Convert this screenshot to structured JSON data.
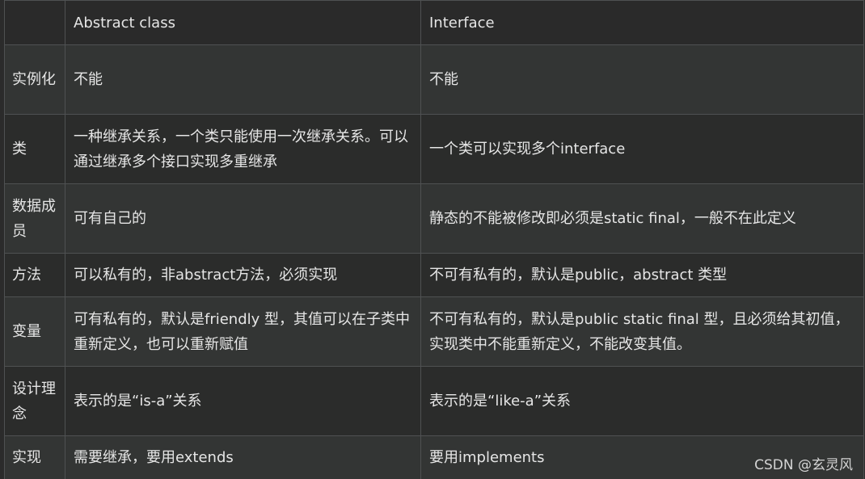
{
  "table": {
    "headers": [
      "",
      "Abstract class",
      "Interface"
    ],
    "rows": [
      {
        "label": "实例化",
        "abstract": "不能",
        "interface": "不能"
      },
      {
        "label": "类",
        "abstract": "一种继承关系，一个类只能使用一次继承关系。可以通过继承多个接口实现多重继承",
        "interface": "一个类可以实现多个interface"
      },
      {
        "label": "数据成员",
        "abstract": "可有自己的",
        "interface": "静态的不能被修改即必须是static final，一般不在此定义"
      },
      {
        "label": "方法",
        "abstract": "可以私有的，非abstract方法，必须实现",
        "interface": "不可有私有的，默认是public，abstract 类型"
      },
      {
        "label": "变量",
        "abstract": "可有私有的，默认是friendly 型，其值可以在子类中重新定义，也可以重新赋值",
        "interface": "不可有私有的，默认是public static final 型，且必须给其初值，实现类中不能重新定义，不能改变其值。"
      },
      {
        "label": "设计理念",
        "abstract": "表示的是“is-a”关系",
        "interface": "表示的是“like-a”关系"
      },
      {
        "label": "实现",
        "abstract": "需要继承，要用extends",
        "interface": "要用implements"
      }
    ]
  },
  "watermark": "CSDN @玄灵风"
}
